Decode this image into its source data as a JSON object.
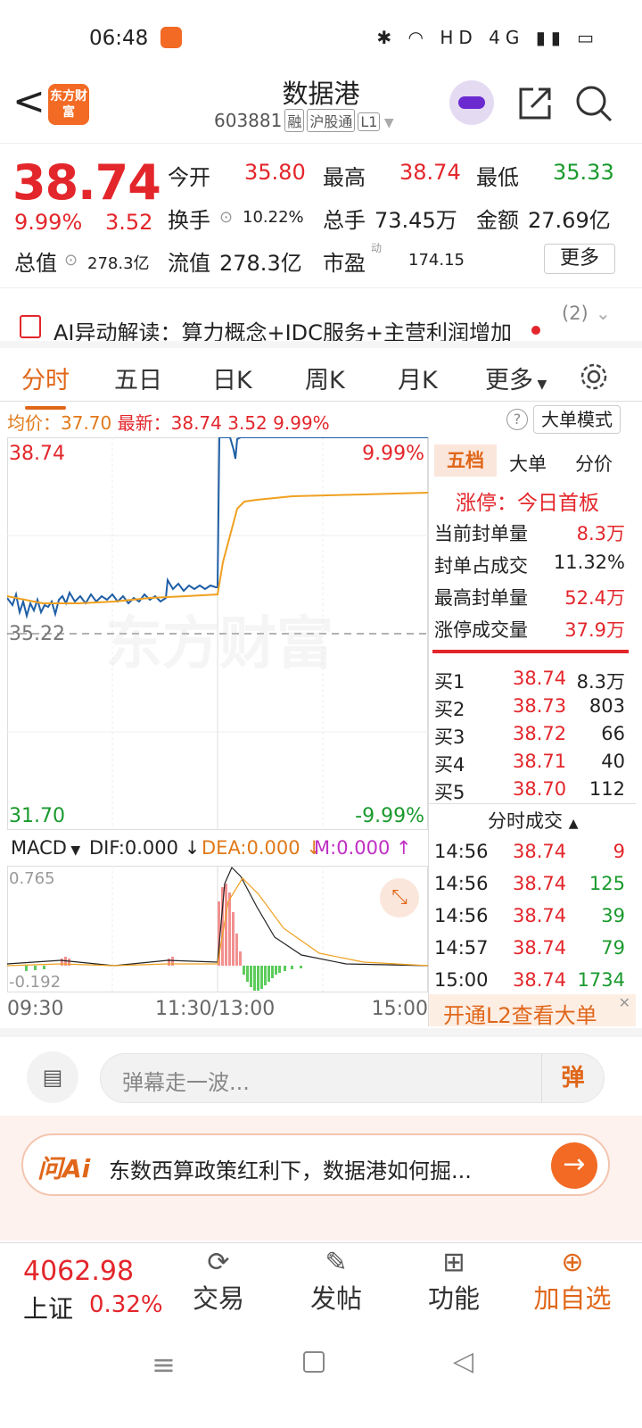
{
  "status": {
    "time": "06:48",
    "icons": "✱ ◠ HD 4G ▮▮ ▭"
  },
  "header": {
    "back_glyph": "<",
    "logo_text": "东方财富",
    "title": "数据港",
    "code": "603881",
    "tags": [
      "融",
      "沪股通",
      "L1"
    ]
  },
  "quote": {
    "price": "38.74",
    "change_pct": "9.99%",
    "change": "3.52",
    "open_label": "今开",
    "open": "35.80",
    "high_label": "最高",
    "high": "38.74",
    "low_label": "最低",
    "low": "35.33",
    "turnover_label": "换手",
    "turnover": "10.22%",
    "volume_label": "总手",
    "volume": "73.45万",
    "amount_label": "金额",
    "amount": "27.69亿",
    "mktcap_label": "总值",
    "mktcap": "278.3亿",
    "float_label": "流值",
    "float": "278.3亿",
    "pe_label": "市盈",
    "pe_sup": "动",
    "pe": "174.15",
    "more_button": "更多"
  },
  "ai_bar": {
    "text": "AI异动解读：算力概念+IDC服务+主营利润增加",
    "count": "(2)"
  },
  "tabs": [
    "分时",
    "五日",
    "日K",
    "周K",
    "月K",
    "更多"
  ],
  "avg_line": {
    "avg_label": "均价：",
    "avg": "37.70",
    "latest_label": "最新：",
    "latest": "38.74",
    "chg": "3.52",
    "pct": "9.99%",
    "mode_button": "大单模式"
  },
  "chart": {
    "top_price": "38.74",
    "top_pct": "9.99%",
    "mid_price": "35.22",
    "bottom_price": "31.70",
    "bottom_pct": "-9.99%",
    "watermark": "东方财富"
  },
  "macd": {
    "indicator": "MACD",
    "dif": "DIF:0.000",
    "dea": "DEA:0.000",
    "m": "M:0.000",
    "max": "0.765",
    "min": "-0.192"
  },
  "time_axis": [
    "09:30",
    "11:30/13:00",
    "15:00"
  ],
  "orderbook": {
    "tabs": [
      "五档",
      "大单",
      "分价"
    ],
    "limit_label": "涨停：今日首板",
    "stats": [
      {
        "label": "当前封单量",
        "value": "8.3万"
      },
      {
        "label": "封单占成交",
        "value": "11.32%"
      },
      {
        "label": "最高封单量",
        "value": "52.4万"
      },
      {
        "label": "涨停成交量",
        "value": "37.9万"
      }
    ],
    "bids": [
      {
        "label": "买1",
        "price": "38.74",
        "vol": "8.3万"
      },
      {
        "label": "买2",
        "price": "38.73",
        "vol": "803"
      },
      {
        "label": "买3",
        "price": "38.72",
        "vol": "66"
      },
      {
        "label": "买4",
        "price": "38.71",
        "vol": "40"
      },
      {
        "label": "买5",
        "price": "38.70",
        "vol": "112"
      }
    ],
    "trades_title": "分时成交",
    "trades": [
      {
        "time": "14:56",
        "price": "38.74",
        "vol": "9"
      },
      {
        "time": "14:56",
        "price": "38.74",
        "vol": "125"
      },
      {
        "time": "14:56",
        "price": "38.74",
        "vol": "39"
      },
      {
        "time": "14:57",
        "price": "38.74",
        "vol": "79"
      },
      {
        "time": "15:00",
        "price": "38.74",
        "vol": "1734"
      }
    ],
    "l2_banner": "开通L2查看大单"
  },
  "comment": {
    "placeholder": "弹幕走一波...",
    "danmu": "弹"
  },
  "promo": {
    "brand": "问Ai",
    "text": "东数西算政策红利下，数据港如何掘..."
  },
  "tabbar": {
    "index_value": "4062.98",
    "index_name": "上证",
    "index_pct": "0.32%",
    "items": [
      "交易",
      "发帖",
      "功能",
      "加自选"
    ]
  }
}
